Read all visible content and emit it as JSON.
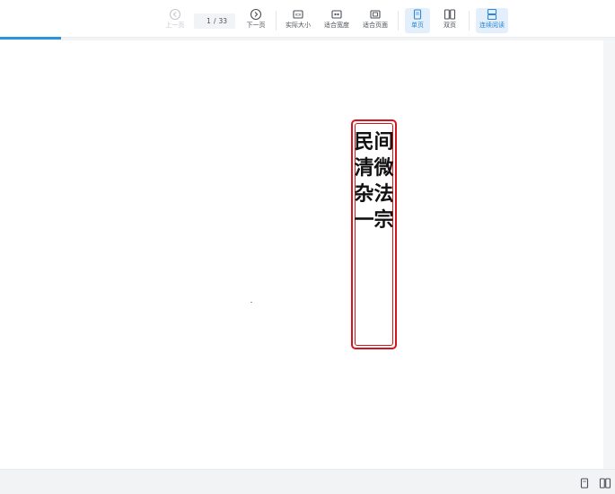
{
  "toolbar": {
    "prev_label": "上一页",
    "next_label": "下一页",
    "current_page": "1",
    "page_separator": "/",
    "total_pages": "33",
    "actual_size_label": "实际大小",
    "fit_width_label": "适合宽度",
    "fit_page_label": "适合页面",
    "single_page_label": "单页",
    "double_page_label": "双页",
    "continuous_label": "连续阅读"
  },
  "document": {
    "title_text": "民间清微杂法一宗"
  },
  "colors": {
    "accent": "#2b93d8",
    "seal_red": "#d4161c",
    "active_bg": "#e3f0fc"
  }
}
